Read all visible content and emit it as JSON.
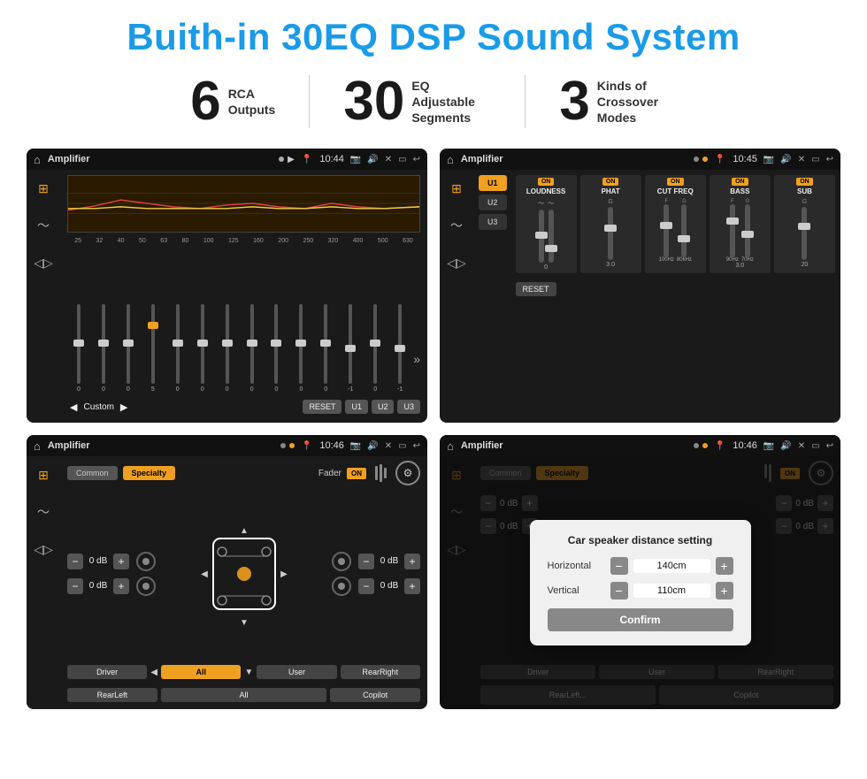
{
  "title": "Buith-in 30EQ DSP Sound System",
  "stats": [
    {
      "number": "6",
      "label": "RCA\nOutputs"
    },
    {
      "number": "30",
      "label": "EQ Adjustable\nSegments"
    },
    {
      "number": "3",
      "label": "Kinds of\nCrossover Modes"
    }
  ],
  "screens": [
    {
      "id": "eq-screen",
      "status_bar": {
        "title": "Amplifier",
        "time": "10:44",
        "icons": "▶"
      },
      "type": "eq"
    },
    {
      "id": "crossover-screen",
      "status_bar": {
        "title": "Amplifier",
        "time": "10:45"
      },
      "type": "crossover"
    },
    {
      "id": "fader-screen",
      "status_bar": {
        "title": "Amplifier",
        "time": "10:46"
      },
      "type": "fader"
    },
    {
      "id": "dialog-screen",
      "status_bar": {
        "title": "Amplifier",
        "time": "10:46"
      },
      "type": "dialog"
    }
  ],
  "eq": {
    "frequencies": [
      "25",
      "32",
      "40",
      "50",
      "63",
      "80",
      "100",
      "125",
      "160",
      "200",
      "250",
      "320",
      "400",
      "500",
      "630"
    ],
    "values": [
      "0",
      "0",
      "0",
      "5",
      "0",
      "0",
      "0",
      "0",
      "0",
      "0",
      "0",
      "-1",
      "0",
      "-1"
    ],
    "preset": "Custom",
    "buttons": [
      "RESET",
      "U1",
      "U2",
      "U3"
    ]
  },
  "crossover": {
    "u_buttons": [
      "U1",
      "U2",
      "U3"
    ],
    "modules": [
      {
        "title": "LOUDNESS",
        "on": true
      },
      {
        "title": "PHAT",
        "on": true
      },
      {
        "title": "CUT FREQ",
        "on": true
      },
      {
        "title": "BASS",
        "on": true
      },
      {
        "title": "SUB",
        "on": true
      }
    ],
    "reset_label": "RESET"
  },
  "fader": {
    "tabs": [
      "Common",
      "Specialty"
    ],
    "active_tab": "Specialty",
    "fader_label": "Fader",
    "on": true,
    "channels": [
      {
        "label": "",
        "db": "0 dB"
      },
      {
        "label": "",
        "db": "0 dB"
      },
      {
        "label": "",
        "db": "0 dB"
      },
      {
        "label": "",
        "db": "0 dB"
      }
    ],
    "bottom_buttons": [
      "Driver",
      "",
      "",
      "User",
      "RearRight"
    ],
    "all_btn": "All",
    "rear_left": "RearLeft",
    "copilot": "Copilot"
  },
  "dialog": {
    "title": "Car speaker distance setting",
    "horizontal_label": "Horizontal",
    "horizontal_value": "140cm",
    "vertical_label": "Vertical",
    "vertical_value": "110cm",
    "confirm_label": "Confirm",
    "tabs": [
      "Common",
      "Specialty"
    ],
    "bottom_buttons": [
      "Driver",
      "",
      "User",
      "RearRight"
    ],
    "rear_left": "RearLeft...",
    "copilot": "Copilot"
  },
  "colors": {
    "accent": "#f0a020",
    "blue_title": "#1a9be8",
    "bg_dark": "#1a1a1a",
    "bg_screen": "#111"
  }
}
